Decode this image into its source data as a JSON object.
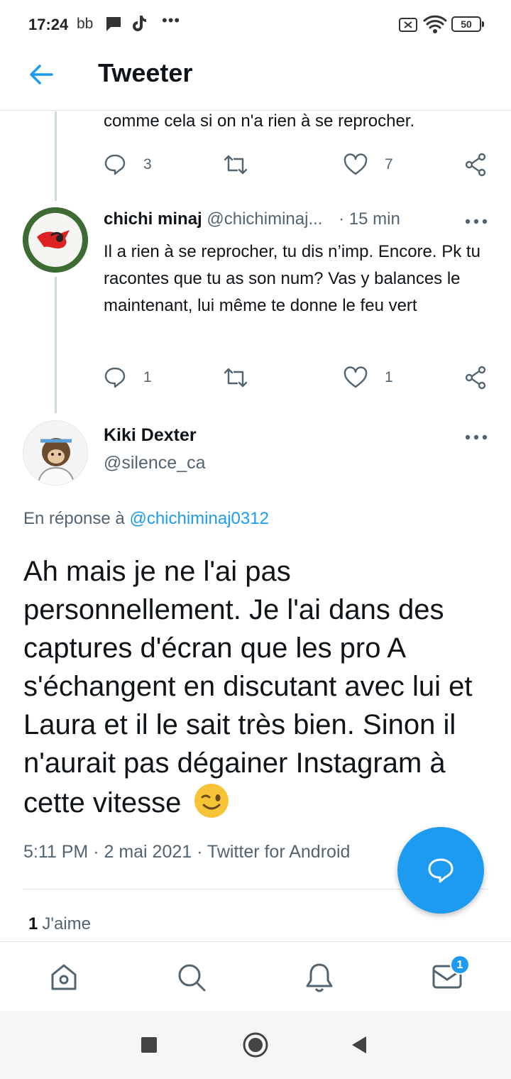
{
  "status_bar": {
    "time": "17:24",
    "carrier": "bb",
    "battery": "50"
  },
  "header": {
    "title": "Tweeter"
  },
  "prev_tweet": {
    "text_tail": "comme cela si on n'a rien à se reprocher.",
    "reply_count": "3",
    "like_count": "7"
  },
  "reply_tweet": {
    "name": "chichi minaj",
    "handle": "@chichiminaj...",
    "time": "· 15 min",
    "text": "Il a rien à se reprocher, tu dis n’imp. Encore. Pk tu racontes que tu as son num? Vas y balances le maintenant, lui même te donne le feu vert",
    "reply_count": "1",
    "like_count": "1"
  },
  "main_tweet": {
    "name": "Kiki Dexter",
    "handle": "@silence_ca",
    "reply_prefix": "En réponse à",
    "reply_to": "@chichiminaj0312",
    "text": "Ah mais je ne l'ai pas personnellement. Je l'ai dans des captures d'écran que les pro A s'échangent en discutant avec lui et Laura et il le sait très bien. Sinon il n'aurait pas dégainer Instagram à cette vitesse",
    "meta": "5:11 PM · 2 mai 2021 · Twitter for Android",
    "likes_count": "1",
    "likes_label": "J'aime"
  },
  "bottom_nav": {
    "messages_badge": "1"
  },
  "colors": {
    "accent": "#1d9bf0",
    "text": "#0f1419",
    "muted": "#536471"
  }
}
